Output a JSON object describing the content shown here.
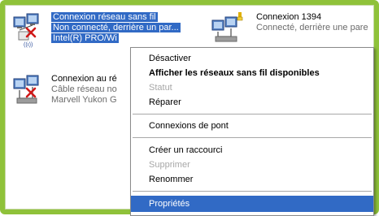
{
  "colors": {
    "frame": "#8fc23a",
    "selection": "#316ac5",
    "menu_hover": "#316ac5",
    "disabled_text": "#a7a7a7",
    "error_x": "#d01818"
  },
  "connections": [
    {
      "name": "Connexion réseau sans fil",
      "status": "Non connecté, derrière un par...",
      "device": "Intel(R) PRO/Wi",
      "selected": true,
      "icon": "wireless-network-disconnected-icon"
    },
    {
      "name": "Connexion 1394",
      "status": "Connecté, derrière une pare",
      "device": "",
      "selected": false,
      "icon": "network-connection-icon"
    },
    {
      "name": "Connexion au ré",
      "status": "Câble réseau no",
      "device": "Marvell Yukon G",
      "selected": false,
      "icon": "lan-disconnected-icon"
    }
  ],
  "context_menu": {
    "items": [
      {
        "label": "Désactiver",
        "state": "normal"
      },
      {
        "label": "Afficher les réseaux sans fil disponibles",
        "state": "bold"
      },
      {
        "label": "Statut",
        "state": "disabled"
      },
      {
        "label": "Réparer",
        "state": "normal"
      },
      {
        "label": "Connexions de pont",
        "state": "normal"
      },
      {
        "label": "Créer un raccourci",
        "state": "normal"
      },
      {
        "label": "Supprimer",
        "state": "disabled"
      },
      {
        "label": "Renommer",
        "state": "normal"
      },
      {
        "label": "Propriétés",
        "state": "hover"
      }
    ]
  }
}
